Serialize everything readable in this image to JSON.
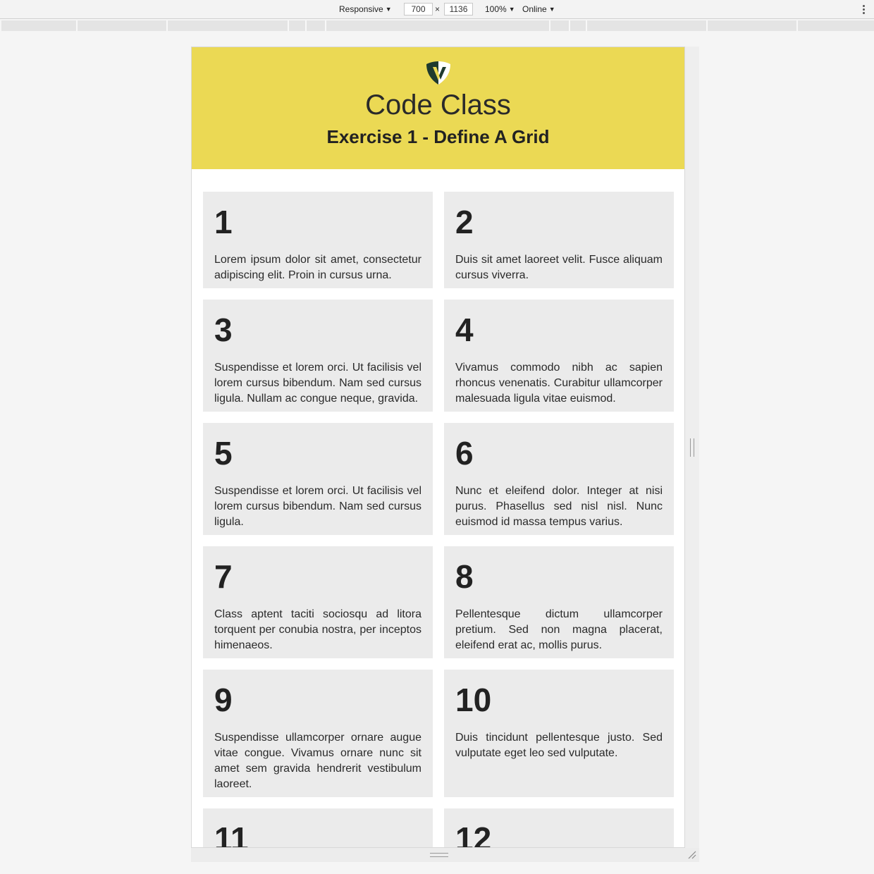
{
  "devtools": {
    "device_mode": "Responsive",
    "width": "700",
    "times": "×",
    "height": "1136",
    "zoom": "100%",
    "throttle": "Online"
  },
  "header": {
    "title": "Code Class",
    "subtitle": "Exercise 1 - Define A Grid"
  },
  "cells": [
    {
      "number": "1",
      "text": "Lorem ipsum dolor sit amet, consectetur adipiscing elit. Proin in cursus urna."
    },
    {
      "number": "2",
      "text": "Duis sit amet laoreet velit. Fusce aliquam cursus viverra."
    },
    {
      "number": "3",
      "text": "Suspendisse et lorem orci. Ut facilisis vel lorem cursus bibendum. Nam sed cursus ligula. Nullam ac congue neque, gravida."
    },
    {
      "number": "4",
      "text": "Vivamus commodo nibh ac sapien rhoncus venenatis. Curabitur ullamcorper malesuada ligula vitae euismod."
    },
    {
      "number": "5",
      "text": "Suspendisse et lorem orci. Ut facilisis vel lorem cursus bibendum. Nam sed cursus ligula."
    },
    {
      "number": "6",
      "text": "Nunc et eleifend dolor. Integer at nisi purus. Phasellus sed nisl nisl. Nunc euismod id massa tempus varius."
    },
    {
      "number": "7",
      "text": "Class aptent taciti sociosqu ad litora torquent per conubia nostra, per inceptos himenaeos."
    },
    {
      "number": "8",
      "text": "Pellentesque dictum ullamcorper pretium. Sed non magna placerat, eleifend erat ac, mollis purus."
    },
    {
      "number": "9",
      "text": "Suspendisse ullamcorper ornare augue vitae congue. Vivamus ornare nunc sit amet sem gravida hendrerit vestibulum laoreet."
    },
    {
      "number": "10",
      "text": "Duis tincidunt pellentesque justo. Sed vulputate eget leo sed vulputate."
    },
    {
      "number": "11",
      "text": ""
    },
    {
      "number": "12",
      "text": ""
    }
  ],
  "colors": {
    "header_bg": "#ebd954",
    "cell_bg": "#ebebeb",
    "logo_dark": "#1f3a2e"
  }
}
